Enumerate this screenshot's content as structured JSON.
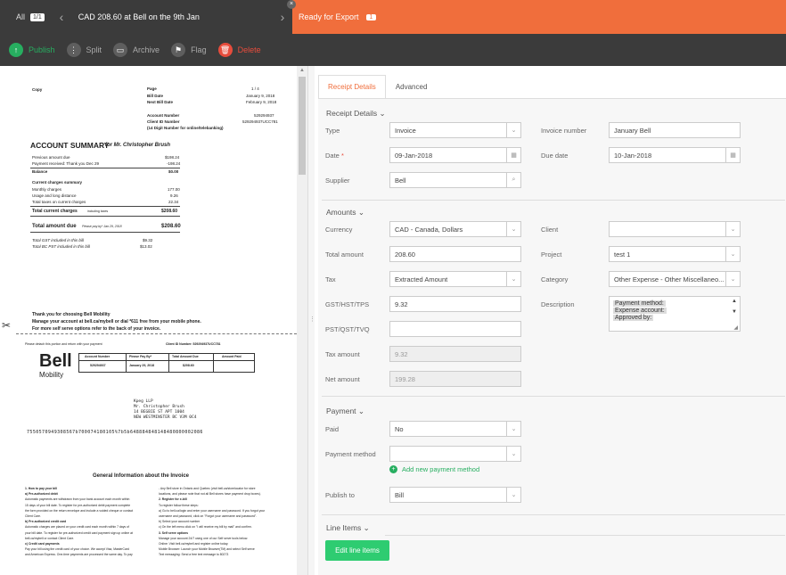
{
  "topbar": {
    "all_label": "All",
    "count": "1/1",
    "title": "CAD 208.60 at Bell on the 9th Jan",
    "ready_label": "Ready for Export",
    "ready_count": "1",
    "close_glyph": "×"
  },
  "actions": {
    "publish": "Publish",
    "split": "Split",
    "archive": "Archive",
    "flag": "Flag",
    "delete": "Delete"
  },
  "tabs": {
    "receipt_details": "Receipt Details",
    "advanced": "Advanced"
  },
  "sections": {
    "receipt_details": "Receipt Details",
    "amounts": "Amounts",
    "payment": "Payment",
    "line_items": "Line Items"
  },
  "form": {
    "type_label": "Type",
    "type_value": "Invoice",
    "invoice_number_label": "Invoice number",
    "invoice_number_value": "January Bell",
    "date_label": "Date",
    "date_value": "09-Jan-2018",
    "due_date_label": "Due date",
    "due_date_value": "10-Jan-2018",
    "supplier_label": "Supplier",
    "supplier_value": "Bell",
    "currency_label": "Currency",
    "currency_value": "CAD - Canada, Dollars",
    "client_label": "Client",
    "client_value": "",
    "total_amount_label": "Total amount",
    "total_amount_value": "208.60",
    "project_label": "Project",
    "project_value": "test 1",
    "tax_label": "Tax",
    "tax_value": "Extracted Amount",
    "category_label": "Category",
    "category_value": "Other Expense - Other Miscellaneo...",
    "gst_label": "GST/HST/TPS",
    "gst_value": "9.32",
    "description_label": "Description",
    "description_lines": [
      "Payment method:",
      "Expense account:",
      "Approved by:"
    ],
    "pst_label": "PST/QST/TVQ",
    "pst_value": "",
    "tax_amount_label": "Tax amount",
    "tax_amount_value": "9.32",
    "net_amount_label": "Net amount",
    "net_amount_value": "199.28",
    "paid_label": "Paid",
    "paid_value": "No",
    "payment_method_label": "Payment method",
    "payment_method_value": "",
    "add_payment_method": "Add new payment method",
    "publish_to_label": "Publish to",
    "publish_to_value": "Bill",
    "edit_line_items": "Edit line items"
  },
  "doc": {
    "copy": "Copy",
    "page_label": "Page",
    "page_value": "1 / 4",
    "bill_date_label": "Bill Date",
    "bill_date_value": "January 9, 2018",
    "next_bill_label": "Next Bill Date",
    "next_bill_value": "February 9, 2018",
    "account_number_label": "Account Number",
    "account_number_value": "529294937",
    "client_id_label": "Client ID Number",
    "client_id_value": "529294937UCC781",
    "digit_note": "(14 Digit Number for online/telebanking)",
    "summary_title": "ACCOUNT SUMMARY",
    "summary_for": "for Mr. Christopher Brush",
    "rows": [
      {
        "label": "Previous amount due",
        "value": "$198.24"
      },
      {
        "label": "Payment received: Thank you Dec 29",
        "value": "-198.24"
      },
      {
        "label": "Balance",
        "value": "$0.00"
      },
      {
        "label": "Current charges summary",
        "value": ""
      },
      {
        "label": "Monthly charges",
        "value": "177.00"
      },
      {
        "label": "Usage and long distance",
        "value": "9.26"
      },
      {
        "label": "Total taxes on current charges",
        "value": "22.34"
      },
      {
        "label": "Total current charges",
        "value": "$208.60"
      },
      {
        "label": "Total amount due",
        "value": "$208.60"
      }
    ],
    "including_taxes": "including taxes",
    "pay_by": "Please pay by* Jan 29, 2018",
    "gst_note": "Total GST included in this bill",
    "gst_note_value": "$9.32",
    "pst_note": "Total BC PST included in this bill",
    "pst_note_value": "$13.02",
    "thanks1": "Thank you for choosing Bell Mobility",
    "thanks2": "Manage your account at bell.ca/mybell or dial *611 free from your mobile phone.",
    "thanks3": "For more self serve options refer to the back of your invoice.",
    "detach": "Please detach this portion and return with your payment",
    "client_id_stub": "Client ID Number: 529294937UCC781",
    "logo_bell": "Bell",
    "logo_mobility": "Mobility",
    "stub_headers": [
      "Account Number",
      "Please Pay By*",
      "Total Amount Due",
      "Amount Paid"
    ],
    "stub_values": [
      "529294937",
      "January 29, 2018",
      "$208.60",
      ""
    ],
    "addr1": "Kpeg LLP",
    "addr2": "Mr. Christopher Brush",
    "addr3": "14 BEGBIE ST APT 1004",
    "addr4": "NEW WESTMINSTER BC  V3M 0C4",
    "barcode": "7550570949308567b700074180105%7b5b648884848148480800002086",
    "gen_info": "General Information about the Invoice",
    "info_left": [
      "1. How to pay your bill",
      "a) Pre-authorized debit",
      "Automatic payments are withdrawn from your bank account each month within",
      "15 days of your bill date. To register for pre-authorized debit payment complete",
      "the form provided on the return envelope and include a voided cheque or contact",
      "Client Care.",
      "b) Pre-authorized credit card",
      "Automatic charges are placed on your credit card each month within 7 days of",
      "your bill date. To register for pre-authorized credit card payment sign up online at",
      "bell.ca/mybell or contact Client Care.",
      "c) Credit card payments",
      "Pay your bill using the credit card of your choice. We accept Visa, MasterCard",
      "and American Express. One-time payments are processed the same day. To pay"
    ],
    "info_right": [
      "- Any Bell store in Ontario and Quebec (visit bell.ca/storelocator for store",
      "locations, and please note that not all Bell stores have payment drop boxes).",
      "2. Register for e-bill",
      "To register follow these steps:",
      "a) Go to bell.ca/login and enter your username and password. If you forgot your",
      "username and password, click on \"Forgot your username and password\".",
      "b) Select your account number",
      "c) On the left menu click on \"I will receive my bill by mail\" and confirm.",
      "3. Self serve options",
      "Manage your account 24/7 using one of our Self serve tools below.",
      "Online: Visit bell.ca/mybell and register online today.",
      "Mobile Browser: Launch your Mobile Browser(TM) and select Self serve",
      "Text messaging: Send a free text message to 80273"
    ]
  }
}
